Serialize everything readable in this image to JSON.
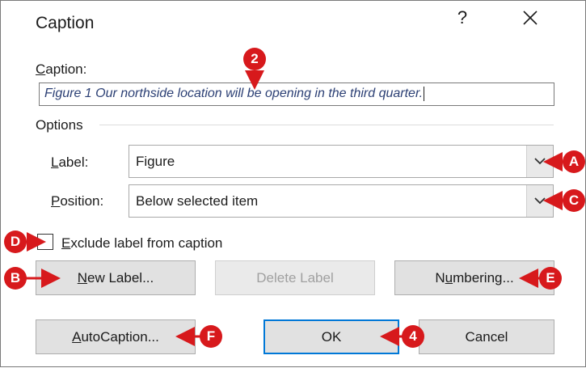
{
  "dialog": {
    "title": "Caption",
    "help": "?"
  },
  "caption": {
    "label": "Caption:",
    "value": "Figure 1 Our northside location will be opening in the third quarter."
  },
  "options": {
    "heading": "Options",
    "label_label": "Label:",
    "label_value": "Figure",
    "position_label": "Position:",
    "position_value": "Below selected item",
    "exclude_label": "Exclude label from caption"
  },
  "buttons": {
    "new_label": "New Label...",
    "delete_label": "Delete Label",
    "numbering": "Numbering...",
    "autocaption": "AutoCaption...",
    "ok": "OK",
    "cancel": "Cancel"
  },
  "callouts": {
    "a": "A",
    "b": "B",
    "c": "C",
    "d": "D",
    "e": "E",
    "f": "F",
    "two": "2",
    "four": "4"
  },
  "colors": {
    "callout": "#d7191c",
    "default_button_border": "#0078d7",
    "caption_text": "#2b3f74"
  },
  "icons": {
    "close": "close-icon",
    "dropdown": "chevron-down-icon"
  }
}
